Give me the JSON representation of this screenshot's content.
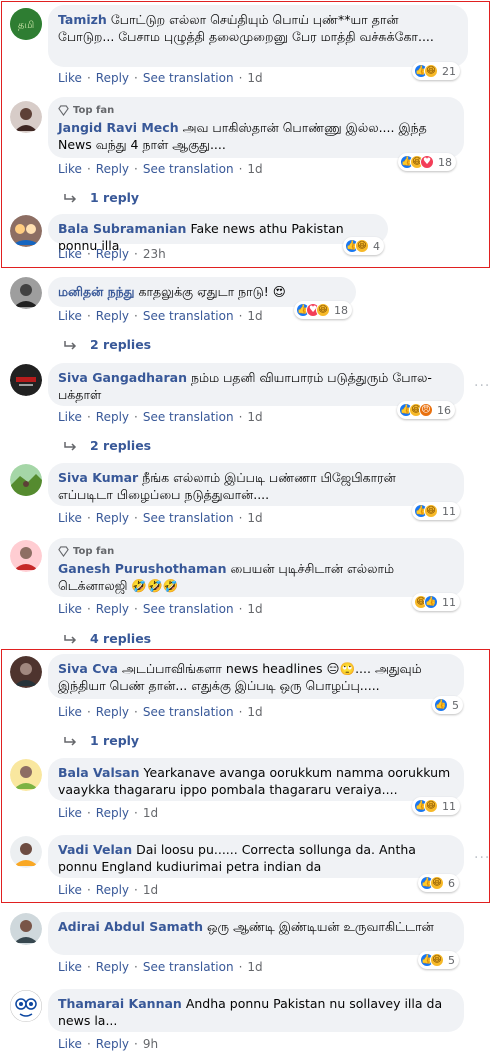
{
  "labels": {
    "like": "Like",
    "reply": "Reply",
    "see_translation": "See translation",
    "top_fan": "Top fan"
  },
  "comments": [
    {
      "name": "Tamizh",
      "text": "போட்டுற எல்லா செய்தியும் பொய் புண்**யா தான் போடுற... பேசாம புழுத்தி தலைமுறைனு பேர மாத்தி வச்சுக்கோ....",
      "time": "1d",
      "reactions": [
        "like",
        "haha"
      ],
      "count": "21"
    },
    {
      "name": "Jangid Ravi Mech",
      "text": "அவ பாகிஸ்தான் பொண்ணு இல்ல.... இந்த News வந்து 4 நாள் ஆகுது....",
      "time": "1d",
      "top_fan": true,
      "reactions": [
        "like",
        "haha",
        "love"
      ],
      "count": "18"
    },
    {
      "name": "Bala Subramanian",
      "text": "Fake news athu Pakistan ponnu illa",
      "time": "23h",
      "reactions": [
        "like",
        "haha"
      ],
      "count": "4"
    },
    {
      "name": "மனிதன் நந்து",
      "text": "காதலுக்கு ஏதுடா நாடு! 😍",
      "time": "1d",
      "reactions": [
        "like",
        "love",
        "haha"
      ],
      "count": "18"
    },
    {
      "name": "Siva Gangadharan",
      "text": "நம்ம பதனி வியாபாரம் படுத்துரும் போல- பக்தாள்",
      "time": "1d",
      "reactions": [
        "like",
        "haha",
        "angry"
      ],
      "count": "16"
    },
    {
      "name": "Siva Kumar",
      "text": "நீங்க எல்லாம் இப்படி பண்ணா பிஜேபிகாரன் எப்படிடா பிழைப்பை நடுத்துவான்....",
      "time": "1d",
      "reactions": [
        "like",
        "haha"
      ],
      "count": "11"
    },
    {
      "name": "Ganesh Purushothaman",
      "text": "பையன் புடிச்சிடான் எல்லாம் டெக்னாலஜி 🤣🤣🤣",
      "time": "1d",
      "top_fan": true,
      "reactions": [
        "haha",
        "like"
      ],
      "count": "11"
    },
    {
      "name": "Siva Cva",
      "text": "அடப்பாவிங்களா news headlines 😑🙄.... அதுவும் இந்தியா பெண் தான்... எதுக்கு இப்படி ஒரு பொழப்பு.....",
      "time": "1d",
      "reactions": [
        "like"
      ],
      "count": "5"
    },
    {
      "name": "Bala Valsan",
      "text": "Yearkanave avanga oorukkum namma oorukkum vaaykka thagararu ippo pombala thagararu veraiya....",
      "time": "1d",
      "reactions": [
        "like",
        "haha"
      ],
      "count": "11"
    },
    {
      "name": "Vadi Velan",
      "text": "Dai loosu pu...... Correcta sollunga da. Antha ponnu England kudiurimai petra indian da",
      "time": "1d",
      "reactions": [
        "like",
        "haha"
      ],
      "count": "6"
    },
    {
      "name": "Adirai Abdul Samath",
      "text": "ஒரு ஆண்டி இண்டியன் உருவாகிட்டான்",
      "time": "1d",
      "reactions": [
        "like",
        "haha"
      ],
      "count": "5"
    },
    {
      "name": "Thamarai Kannan",
      "text": "Andha ponnu Pakistan nu sollavey illa da news la...",
      "time": "9h",
      "reactions": [],
      "count": ""
    }
  ],
  "reply_links": [
    "1 reply",
    "2 replies",
    "2 replies",
    "4 replies",
    "1 reply"
  ],
  "colors": {
    "name": "#385898",
    "bubble": "#f0f2f5",
    "highlight_box": "#e02020",
    "like": "#1877f2",
    "haha": "#f7b928",
    "love": "#f33e58",
    "angry": "#e9710f"
  }
}
